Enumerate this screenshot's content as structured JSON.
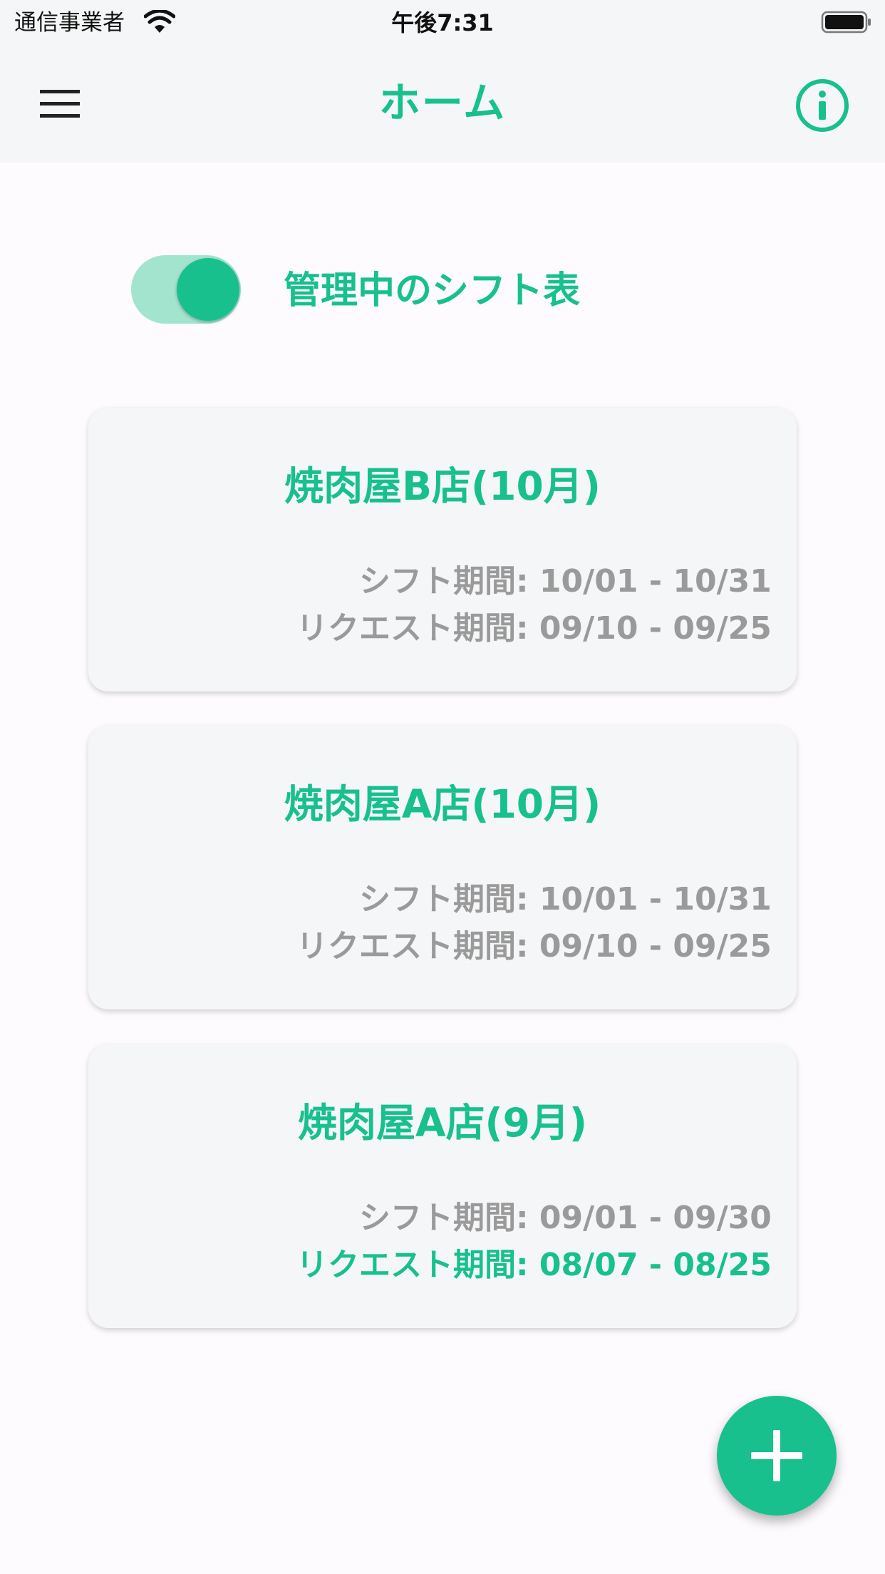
{
  "status_bar": {
    "carrier": "通信事業者",
    "time": "午後7:31",
    "icons": [
      "wifi-icon",
      "battery-icon"
    ]
  },
  "app_bar": {
    "title": "ホーム",
    "left_icon": "menu-icon",
    "right_icon": "info-icon"
  },
  "toggle": {
    "label": "管理中のシフト表",
    "state": "on"
  },
  "cards": [
    {
      "title": "焼肉屋B店(10月)",
      "shift_label": "シフト期間",
      "shift_value": ": 10/01 - 10/31",
      "request_label": "リクエスト期間",
      "request_value": ": 09/10 - 09/25",
      "request_highlighted": false
    },
    {
      "title": "焼肉屋A店(10月)",
      "shift_label": "シフト期間",
      "shift_value": ": 10/01 - 10/31",
      "request_label": "リクエスト期間",
      "request_value": ": 09/10 - 09/25",
      "request_highlighted": false
    },
    {
      "title": "焼肉屋A店(9月)",
      "shift_label": "シフト期間",
      "shift_value": ": 09/01 - 09/30",
      "request_label": "リクエスト期間",
      "request_value": ": 08/07 - 08/25",
      "request_highlighted": true
    }
  ],
  "fab": {
    "icon": "plus-icon"
  },
  "colors": {
    "accent": "#17c08c",
    "toggle_track": "#a3e4cf",
    "muted_text": "#9a9a9a",
    "card_background": "#f5f6f8",
    "page_background": "#fdfbfe"
  }
}
